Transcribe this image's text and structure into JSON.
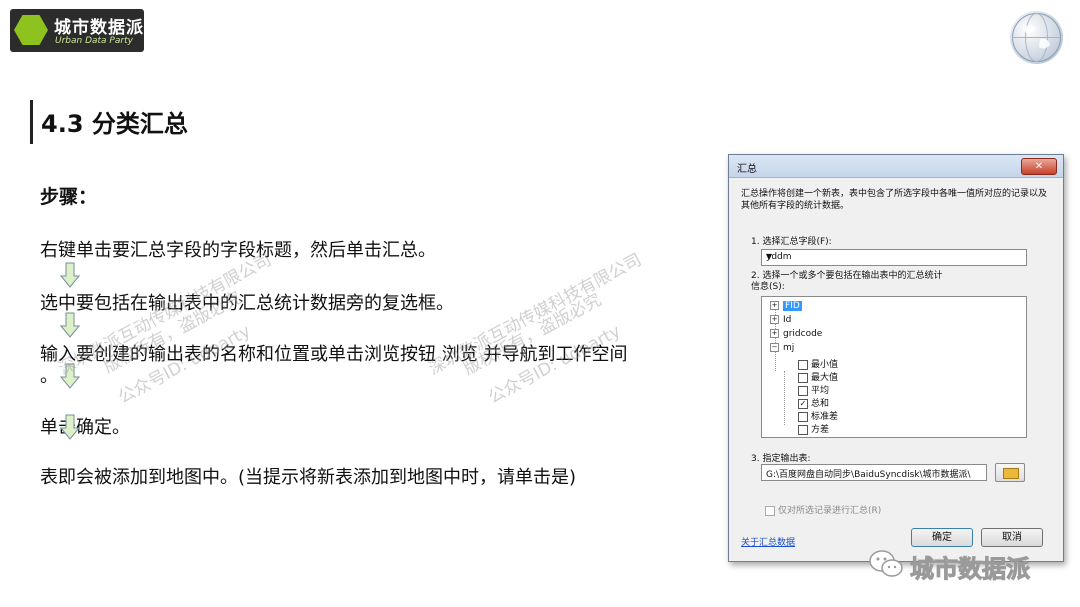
{
  "brand": {
    "name_cn": "城市数据派",
    "name_en": "Urban Data Party"
  },
  "slide": {
    "title": "4.3 分类汇总",
    "steps_label": "步骤：",
    "steps": [
      "右键单击要汇总字段的字段标题，然后单击汇总。",
      "选中要包括在输出表中的汇总统计数据旁的复选框。",
      "输入要创建的输出表的名称和位置或单击浏览按钮 浏览 并导航到工作空间",
      "。",
      "单击确定。",
      "表即会被添加到地图中。(当提示将新表添加到地图中时，请单击是)"
    ]
  },
  "watermarks": [
    "深圳数派互动传媒科技有限公司",
    "版权所有，盗版必究",
    "公众号ID: udparty"
  ],
  "dialog": {
    "title": "汇总",
    "close_glyph": "✕",
    "description": "汇总操作将创建一个新表，表中包含了所选字段中各唯一值所对应的记录以及其他所有字段的统计数据。",
    "step1_label": "1. 选择汇总字段(F):",
    "step1_value": "yddm",
    "step2_label": "2. 选择一个或多个要包括在输出表中的汇总统计信息(S):",
    "tree": {
      "fields": [
        "FID",
        "Id",
        "gridcode",
        "mj"
      ],
      "stats": [
        {
          "label": "最小值",
          "checked": false
        },
        {
          "label": "最大值",
          "checked": false
        },
        {
          "label": "平均",
          "checked": false
        },
        {
          "label": "总和",
          "checked": true
        },
        {
          "label": "标准差",
          "checked": false
        },
        {
          "label": "方差",
          "checked": false
        }
      ]
    },
    "step3_label": "3. 指定输出表:",
    "output_path": "G:\\百度网盘自动同步\\BaiduSyncdisk\\城市数据派\\",
    "selected_only_label": "仅对所选记录进行汇总(R)",
    "help_link": "关于汇总数据",
    "ok_label": "确定",
    "cancel_label": "取消"
  },
  "footer_brand": "城市数据派",
  "colors": {
    "logo_green": "#8dc21f",
    "link_blue": "#1a4fd0",
    "selection_blue": "#3399ff",
    "arrow_green": "#dff0c8"
  }
}
